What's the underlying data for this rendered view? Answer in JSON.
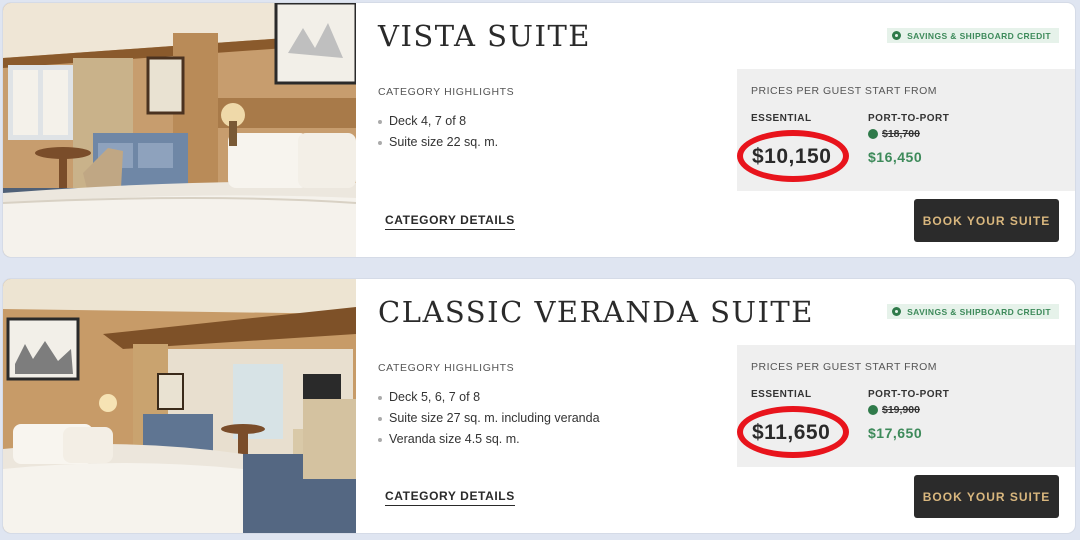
{
  "cards": [
    {
      "title": "VISTA SUITE",
      "badge": "SAVINGS & SHIPBOARD CREDIT",
      "highlights_heading": "CATEGORY HIGHLIGHTS",
      "highlights": [
        "Deck 4, 7 of 8",
        "Suite size 22 sq. m."
      ],
      "details_link": "CATEGORY DETAILS",
      "price_heading": "PRICES PER GUEST START FROM",
      "essential_label": "ESSENTIAL",
      "essential_price": "$10,150",
      "ptp_label": "PORT-TO-PORT",
      "ptp_original": "$18,700",
      "ptp_price": "$16,450",
      "book_button": "BOOK YOUR SUITE"
    },
    {
      "title": "CLASSIC VERANDA SUITE",
      "badge": "SAVINGS & SHIPBOARD CREDIT",
      "highlights_heading": "CATEGORY HIGHLIGHTS",
      "highlights": [
        "Deck 5, 6, 7 of 8",
        "Suite size 27 sq. m. including veranda",
        "Veranda size 4.5 sq. m."
      ],
      "details_link": "CATEGORY DETAILS",
      "price_heading": "PRICES PER GUEST START FROM",
      "essential_label": "ESSENTIAL",
      "essential_price": "$11,650",
      "ptp_label": "PORT-TO-PORT",
      "ptp_original": "$19,900",
      "ptp_price": "$17,650",
      "book_button": "BOOK YOUR SUITE"
    }
  ],
  "colors": {
    "page_bg": "#dfe5f1",
    "highlight_ring": "#e8141c",
    "savings_green": "#3d8a5a",
    "book_button_bg": "#2b2b2b",
    "book_button_text": "#d9b77e"
  }
}
